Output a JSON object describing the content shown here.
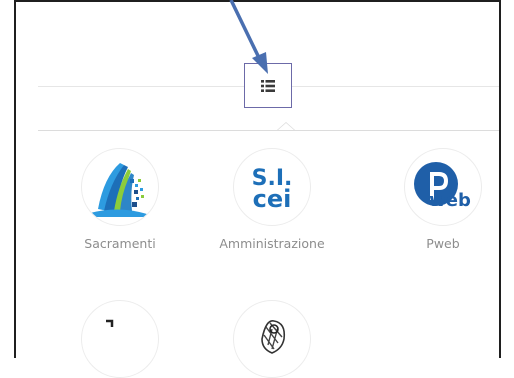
{
  "header": {
    "menu_toggle_icon": "list-icon"
  },
  "apps": [
    {
      "label": "Sacramenti",
      "icon": "sacramenti-logo"
    },
    {
      "label": "Amministrazione",
      "icon": "sicei-logo",
      "logo_text": [
        "S.I.",
        "cei"
      ]
    },
    {
      "label": "Pweb",
      "icon": "pweb-logo",
      "logo_text": "web"
    },
    {
      "label": "",
      "icon": "partial-logo"
    },
    {
      "label": "",
      "icon": "saint-engraving-logo"
    }
  ],
  "colors": {
    "arrow": "#4a6fb0",
    "menu_border": "#6c6aa8",
    "sicei_blue": "#1d6fb8",
    "pweb_blue": "#1f5fa8",
    "label_gray": "#8d8d8d"
  }
}
